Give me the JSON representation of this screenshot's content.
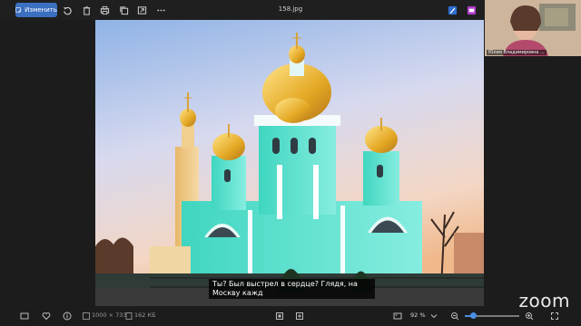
{
  "toolbar": {
    "edit_label": "Изменить",
    "filename": "158.jpg",
    "icons": [
      "rotate-icon",
      "delete-icon",
      "print-icon",
      "copy-icon",
      "share-icon",
      "more-icon",
      "edit-pen-icon",
      "effects-icon"
    ]
  },
  "subtitle": "Ты? Был выстрел в сердце? Глядя, на Москву кажд",
  "webcam": {
    "name": "Юлия Владимировна ..."
  },
  "status": {
    "dimensions": "1000 × 733",
    "size": "162 КБ",
    "zoom": "92 %",
    "zoom_fraction": 0.15
  },
  "brand": {
    "logo": "zoom"
  },
  "colors": {
    "accent": "#3b6fbf",
    "background": "#1c1c1c",
    "slider": "#4a90e2"
  }
}
